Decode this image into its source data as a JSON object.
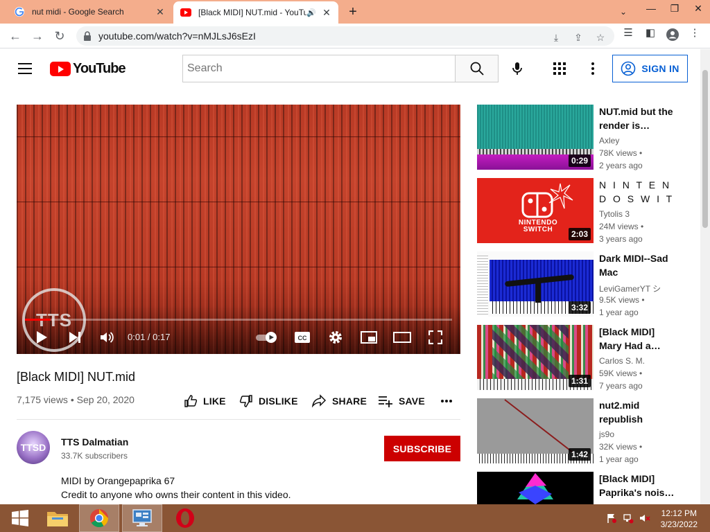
{
  "browser": {
    "tabs": [
      {
        "title": "nut midi - Google Search",
        "active": false
      },
      {
        "title": "[Black MIDI] NUT.mid - YouTube",
        "active": true
      }
    ],
    "url": "youtube.com/watch?v=nMJLsJ6sEzI"
  },
  "youtube": {
    "logo_text": "YouTube",
    "search_placeholder": "Search",
    "signin_label": "SIGN IN"
  },
  "player": {
    "watermark": "TTS",
    "time": "0:01 / 0:17",
    "progress_fraction": 0.06
  },
  "video": {
    "title": "[Black MIDI] NUT.mid",
    "meta": "7,175 views • Sep 20, 2020",
    "actions": {
      "like": "LIKE",
      "dislike": "DISLIKE",
      "share": "SHARE",
      "save": "SAVE"
    },
    "channel": {
      "name": "TTS Dalmatian",
      "subscribers": "33.7K subscribers",
      "avatar_text": "TTSD"
    },
    "subscribe_label": "SUBSCRIBE",
    "description": [
      "MIDI by Orangepaprika 67",
      "Credit to anyone who owns their content in this video."
    ]
  },
  "related": [
    {
      "title": "NUT.mid but the render is…",
      "channel": "Axley",
      "views": "78K views •",
      "age": "2 years ago",
      "duration": "0:29"
    },
    {
      "title": "N I N T E N D O S W I T C H",
      "channel": "Tytolis 3",
      "views": "24M views •",
      "age": "3 years ago",
      "duration": "2:03"
    },
    {
      "title": "Dark MIDI--Sad Mac",
      "channel": "LeviGamerYT シ",
      "views": "9.5K views •",
      "age": "1 year ago",
      "duration": "3:32"
    },
    {
      "title": "[Black MIDI] Mary Had a…",
      "channel": "Carlos S. M.",
      "views": "59K views •",
      "age": "7 years ago",
      "duration": "1:31"
    },
    {
      "title": "nut2.mid republish",
      "channel": "js9o",
      "views": "32K views •",
      "age": "1 year ago",
      "duration": "1:42"
    },
    {
      "title": "[Black MIDI] Paprika's nois…",
      "channel": "",
      "views": "",
      "age": "",
      "duration": ""
    }
  ],
  "thumbs": {
    "switch_logo": "NINTENDO SWITCH"
  },
  "taskbar": {
    "time": "12:12 PM",
    "date": "3/23/2022"
  }
}
